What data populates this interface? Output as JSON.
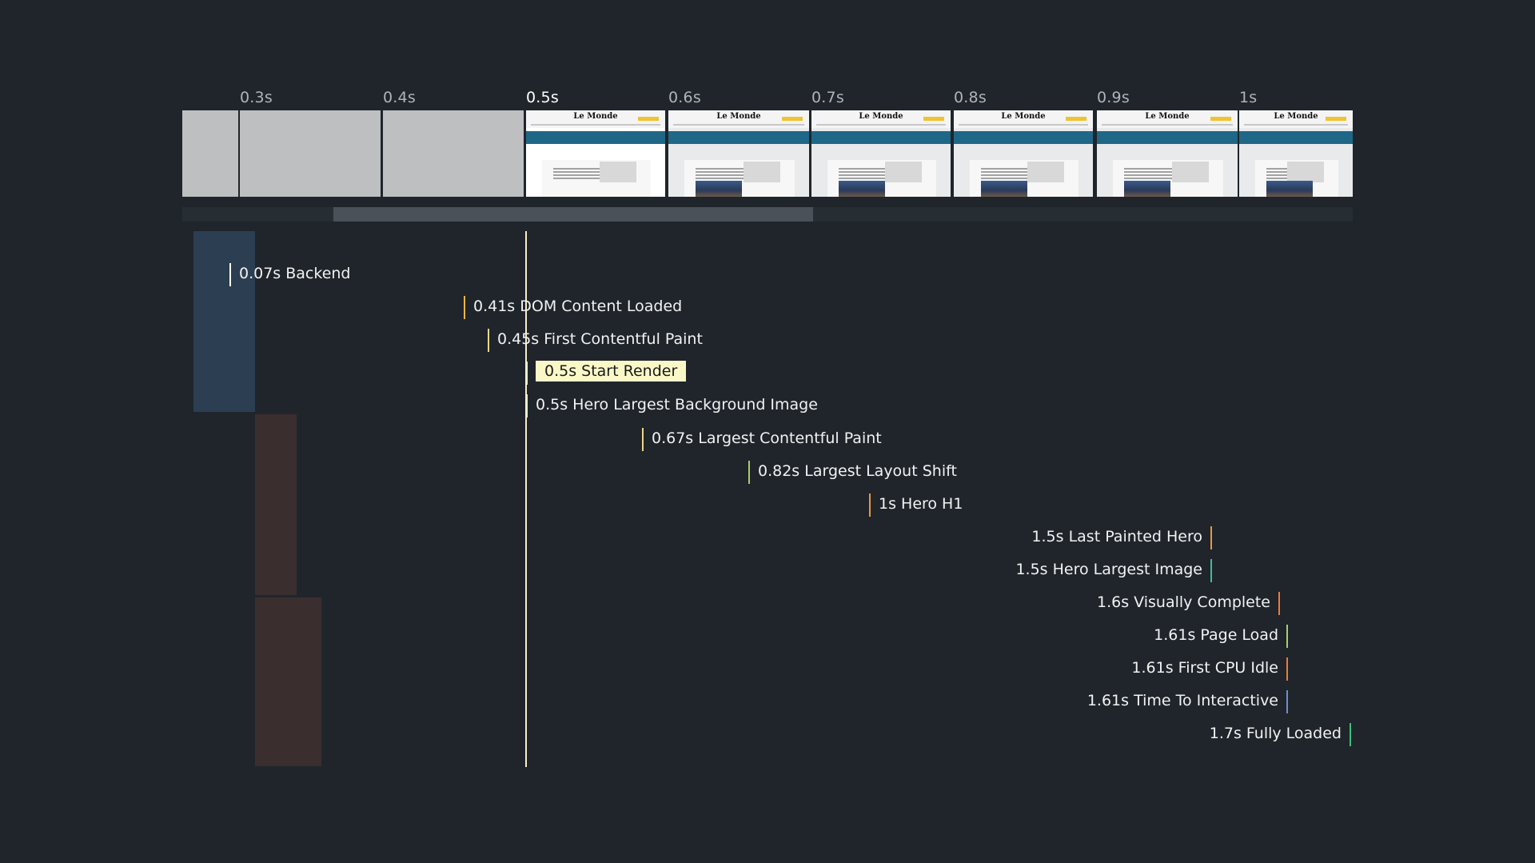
{
  "filmstrip": {
    "ticks": [
      "0.3s",
      "0.4s",
      "0.5s",
      "0.6s",
      "0.7s",
      "0.8s",
      "0.9s",
      "1s"
    ],
    "active_tick": "0.5s",
    "frames": [
      {
        "state": "blank"
      },
      {
        "state": "blank"
      },
      {
        "state": "blank"
      },
      {
        "state": "page",
        "logo": "Le Monde",
        "current": true
      },
      {
        "state": "page",
        "logo": "Le Monde"
      },
      {
        "state": "page",
        "logo": "Le Monde"
      },
      {
        "state": "page",
        "logo": "Le Monde"
      },
      {
        "state": "page",
        "logo": "Le Monde"
      },
      {
        "state": "page",
        "logo": "Le Monde"
      }
    ]
  },
  "request_blocks": [
    {
      "color": "#2c3e51"
    },
    {
      "color": "#3b2e2f"
    },
    {
      "color": "#3b2e2f"
    }
  ],
  "current_time_marker": "0.5s",
  "milestones": [
    {
      "label": "0.07s Backend",
      "color": "#ffffff",
      "side": "left"
    },
    {
      "label": "0.41s DOM Content Loaded",
      "color": "#f0b64a",
      "side": "left"
    },
    {
      "label": "0.45s First Contentful Paint",
      "color": "#f5d68c",
      "side": "left"
    },
    {
      "label": "0.5s Start Render",
      "color": "#f5efc9",
      "side": "left",
      "highlighted": true
    },
    {
      "label": "0.5s Hero Largest Background Image",
      "color": "#f5efc9",
      "side": "left"
    },
    {
      "label": "0.67s Largest Contentful Paint",
      "color": "#f0d58a",
      "side": "left"
    },
    {
      "label": "0.82s Largest Layout Shift",
      "color": "#a9cf6a",
      "side": "left"
    },
    {
      "label": "1s Hero H1",
      "color": "#e89a3c",
      "side": "left"
    },
    {
      "label": "1.5s Last Painted Hero",
      "color": "#e89a3c",
      "side": "right"
    },
    {
      "label": "1.5s Hero Largest Image",
      "color": "#3fbf9a",
      "side": "right"
    },
    {
      "label": "1.6s Visually Complete",
      "color": "#f07a3a",
      "side": "right"
    },
    {
      "label": "1.61s Page Load",
      "color": "#a9cf6a",
      "side": "right"
    },
    {
      "label": "1.61s First CPU Idle",
      "color": "#f07a3a",
      "side": "right"
    },
    {
      "label": "1.61s Time To Interactive",
      "color": "#6f8fd0",
      "side": "right"
    },
    {
      "label": "1.7s Fully Loaded",
      "color": "#3fbf7a",
      "side": "right"
    }
  ]
}
